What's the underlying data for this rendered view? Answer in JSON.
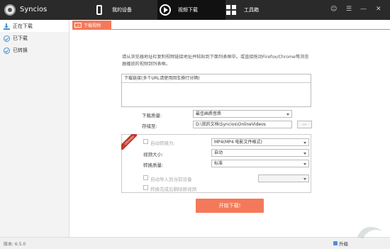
{
  "app": {
    "name": "Syncios",
    "window_controls": [
      "☺",
      "☰",
      "—",
      "✕"
    ]
  },
  "nav": {
    "my_device": "我的设备",
    "video_download": "视频下载",
    "toolbox": "工具箱"
  },
  "sidebar": {
    "items": [
      {
        "label": "正在下载",
        "icon": "download-icon"
      },
      {
        "label": "已下载",
        "icon": "check-circle-icon"
      },
      {
        "label": "已转换",
        "icon": "check-circle-icon"
      }
    ]
  },
  "tab": {
    "label": "下载视频"
  },
  "main": {
    "instructions": "请从浏览器地址栏复制视频链接地址并粘贴到下面列表框中。或直接拖动Firefox/Chrome等浏览器播放的视频到列表框。",
    "url_box_header": "下载链接(多个URL请使用回车换行分隔)",
    "quality_label": "下载质量:",
    "quality_value": "最佳画质音质",
    "save_to_label": "存储至:",
    "save_path": "D:\\我的文档\\Syncios\\OnlineVideos",
    "browse_label": "..."
  },
  "convert": {
    "ribbon": "Ultimate",
    "auto_convert_label": "自动转换为:",
    "auto_convert_value": "MP4(MP4 电影文件格式)",
    "video_size_label": "视频大小:",
    "video_size_value": "自动",
    "convert_quality_label": "转换质量:",
    "convert_quality_value": "标准",
    "auto_import_label": "自动导入到当前设备",
    "delete_after_label": "转换完成后删除原视频"
  },
  "start_button": "开始下载!",
  "footer": {
    "version": "版本: 6.5.0",
    "upgrade": "升级"
  }
}
